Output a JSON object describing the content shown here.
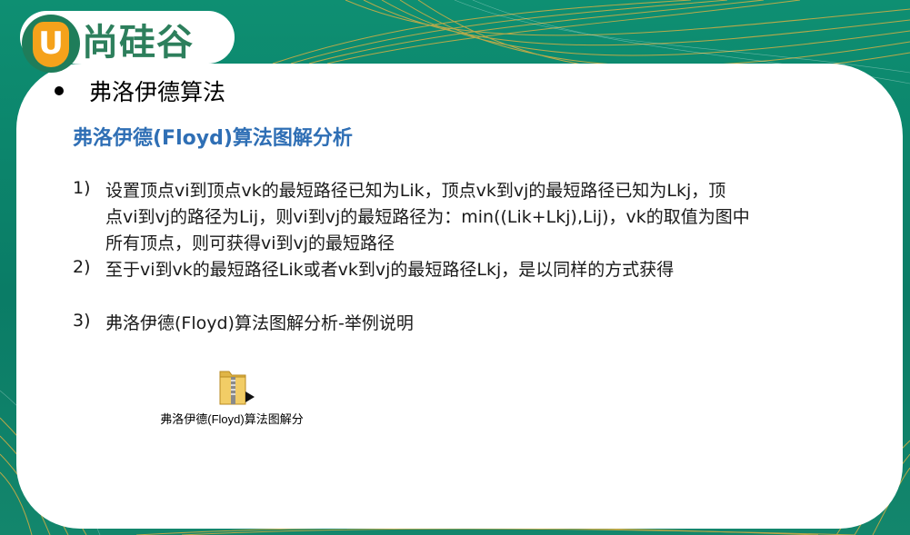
{
  "logo": {
    "mark": "U",
    "name": "尚硅谷"
  },
  "slide": {
    "heading": "弗洛伊德算法",
    "subtitle": "弗洛伊德(Floyd)算法图解分析",
    "items": [
      {
        "num": "1)",
        "lines": [
          "设置顶点vi到顶点vk的最短路径已知为Lik，顶点vk到vj的最短路径已知为Lkj，顶",
          "点vi到vj的路径为Lij，则vi到vj的最短路径为：min((Lik+Lkj),Lij)，vk的取值为图中",
          "所有顶点，则可获得vi到vj的最短路径"
        ]
      },
      {
        "num": "2)",
        "lines": [
          "至于vi到vk的最短路径Lik或者vk到vj的最短路径Lkj，是以同样的方式获得"
        ]
      },
      {
        "num": "3)",
        "lines": [
          "弗洛伊德(Floyd)算法图解分析-举例说明"
        ]
      }
    ]
  },
  "attachment": {
    "icon": "zip-folder-icon",
    "label": "弗洛伊德(Floyd)算法图解分"
  },
  "colors": {
    "background": "#0e8f72",
    "subtitle": "#2f6fb5",
    "logo_green": "#2d7f5c",
    "logo_orange": "#f5a21b",
    "accent_lines": "#f2b33d"
  }
}
